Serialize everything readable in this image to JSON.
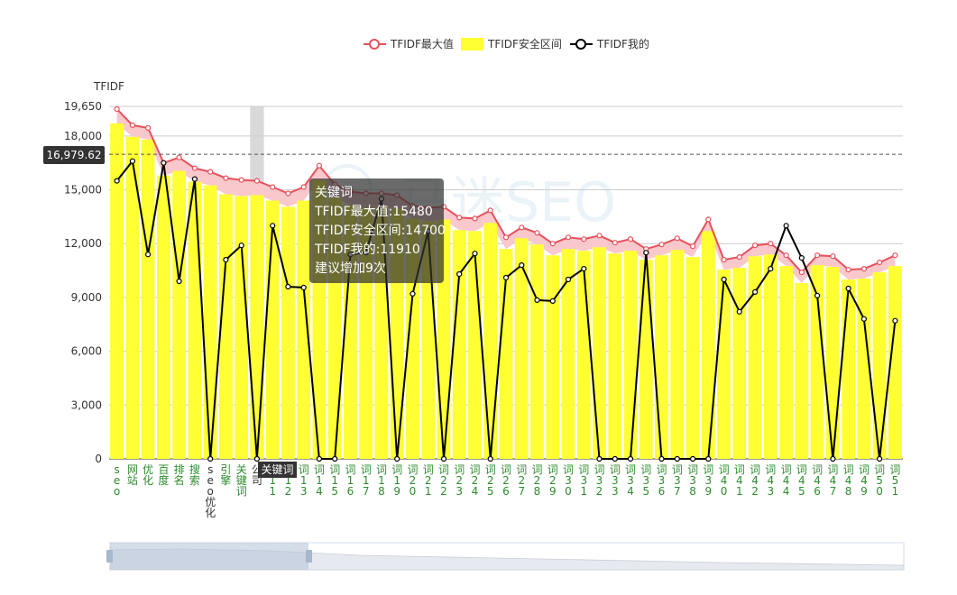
{
  "chart_data": {
    "type": "bar",
    "ylabel": "TFIDF",
    "ylim": [
      0,
      19650
    ],
    "y_ticks": [
      "0",
      "3,000",
      "6,000",
      "9,000",
      "12,000",
      "15,000",
      "18,000",
      "19,650"
    ],
    "grid": true,
    "legend_position": "top-center",
    "categories": [
      "seo",
      "网站",
      "优化",
      "百度",
      "排名",
      "搜索",
      "seo优化",
      "引擎",
      "关键词",
      "公司",
      "词11",
      "词12",
      "词13",
      "词14",
      "词15",
      "词16",
      "词17",
      "词18",
      "词19",
      "词20",
      "词21",
      "词22",
      "词23",
      "词24",
      "词25",
      "词26",
      "词27",
      "词28",
      "词29",
      "词30",
      "词31",
      "词32",
      "词33",
      "词34",
      "词35",
      "词36",
      "词37",
      "词38",
      "词39",
      "词40",
      "词41",
      "词42",
      "词43",
      "词44",
      "词45",
      "词46",
      "词47",
      "词48",
      "词49",
      "词50",
      "词51"
    ],
    "series": [
      {
        "name": "TFIDF最大值",
        "type": "line",
        "color": "#e8505b",
        "values": [
          19500,
          18600,
          18450,
          16500,
          16800,
          16200,
          16000,
          15650,
          15550,
          15500,
          15150,
          14800,
          15150,
          16350,
          15300,
          14900,
          14800,
          14800,
          14700,
          14100,
          14000,
          14050,
          13450,
          13400,
          13850,
          12350,
          12900,
          12600,
          12000,
          12350,
          12250,
          12450,
          12050,
          12250,
          11700,
          11950,
          12300,
          11850,
          13350,
          11100,
          11250,
          11900,
          12000,
          11350,
          10400,
          11350,
          11300,
          10550,
          10600,
          10950,
          11350
        ]
      },
      {
        "name": "TFIDF安全区间",
        "type": "bar",
        "color": "#ffff33",
        "values": [
          18700,
          17950,
          17800,
          15800,
          16050,
          15450,
          15250,
          14750,
          14650,
          14700,
          14400,
          14050,
          14400,
          15550,
          14550,
          14150,
          14000,
          14050,
          13950,
          13400,
          13250,
          13350,
          12750,
          12700,
          13150,
          11700,
          12300,
          11950,
          11350,
          11700,
          11600,
          11800,
          11450,
          11600,
          11100,
          11350,
          11650,
          11250,
          12700,
          10550,
          10650,
          11300,
          11400,
          10750,
          9800,
          10800,
          10700,
          10000,
          10050,
          10400,
          10750
        ]
      },
      {
        "name": "TFIDF我的",
        "type": "line",
        "color": "#000000",
        "values": [
          15500,
          16600,
          11400,
          16500,
          9900,
          15600,
          0,
          11100,
          11900,
          0,
          13000,
          9600,
          9550,
          0,
          0,
          11400,
          11500,
          14500,
          0,
          9200,
          12700,
          0,
          10300,
          11450,
          0,
          10100,
          10800,
          8850,
          8800,
          10000,
          10600,
          0,
          0,
          0,
          11500,
          0,
          0,
          0,
          0,
          10000,
          8200,
          9300,
          10600,
          13000,
          11200,
          9100,
          0,
          9500,
          7800,
          0,
          7700
        ]
      }
    ],
    "pointer_value": "16,979.62",
    "pointer_y": 16979.62,
    "highlight_category_index": 9,
    "highlight_axis_label": "关键词"
  },
  "legend": {
    "max_label": "TFIDF最大值",
    "safe_label": "TFIDF安全区间",
    "mine_label": "TFIDF我的"
  },
  "tooltip": {
    "line1": "关键词",
    "line2": "TFIDF最大值:15480",
    "line3": "TFIDF安全区间:14700",
    "line4": "TFIDF我的:11910",
    "line5": "建议增加9次"
  },
  "watermark": "马迷SEO",
  "colors": {
    "max_fill": "#f8c8cc",
    "axis_label_green": "#2e8b2e",
    "axis_label_black": "#333333"
  }
}
